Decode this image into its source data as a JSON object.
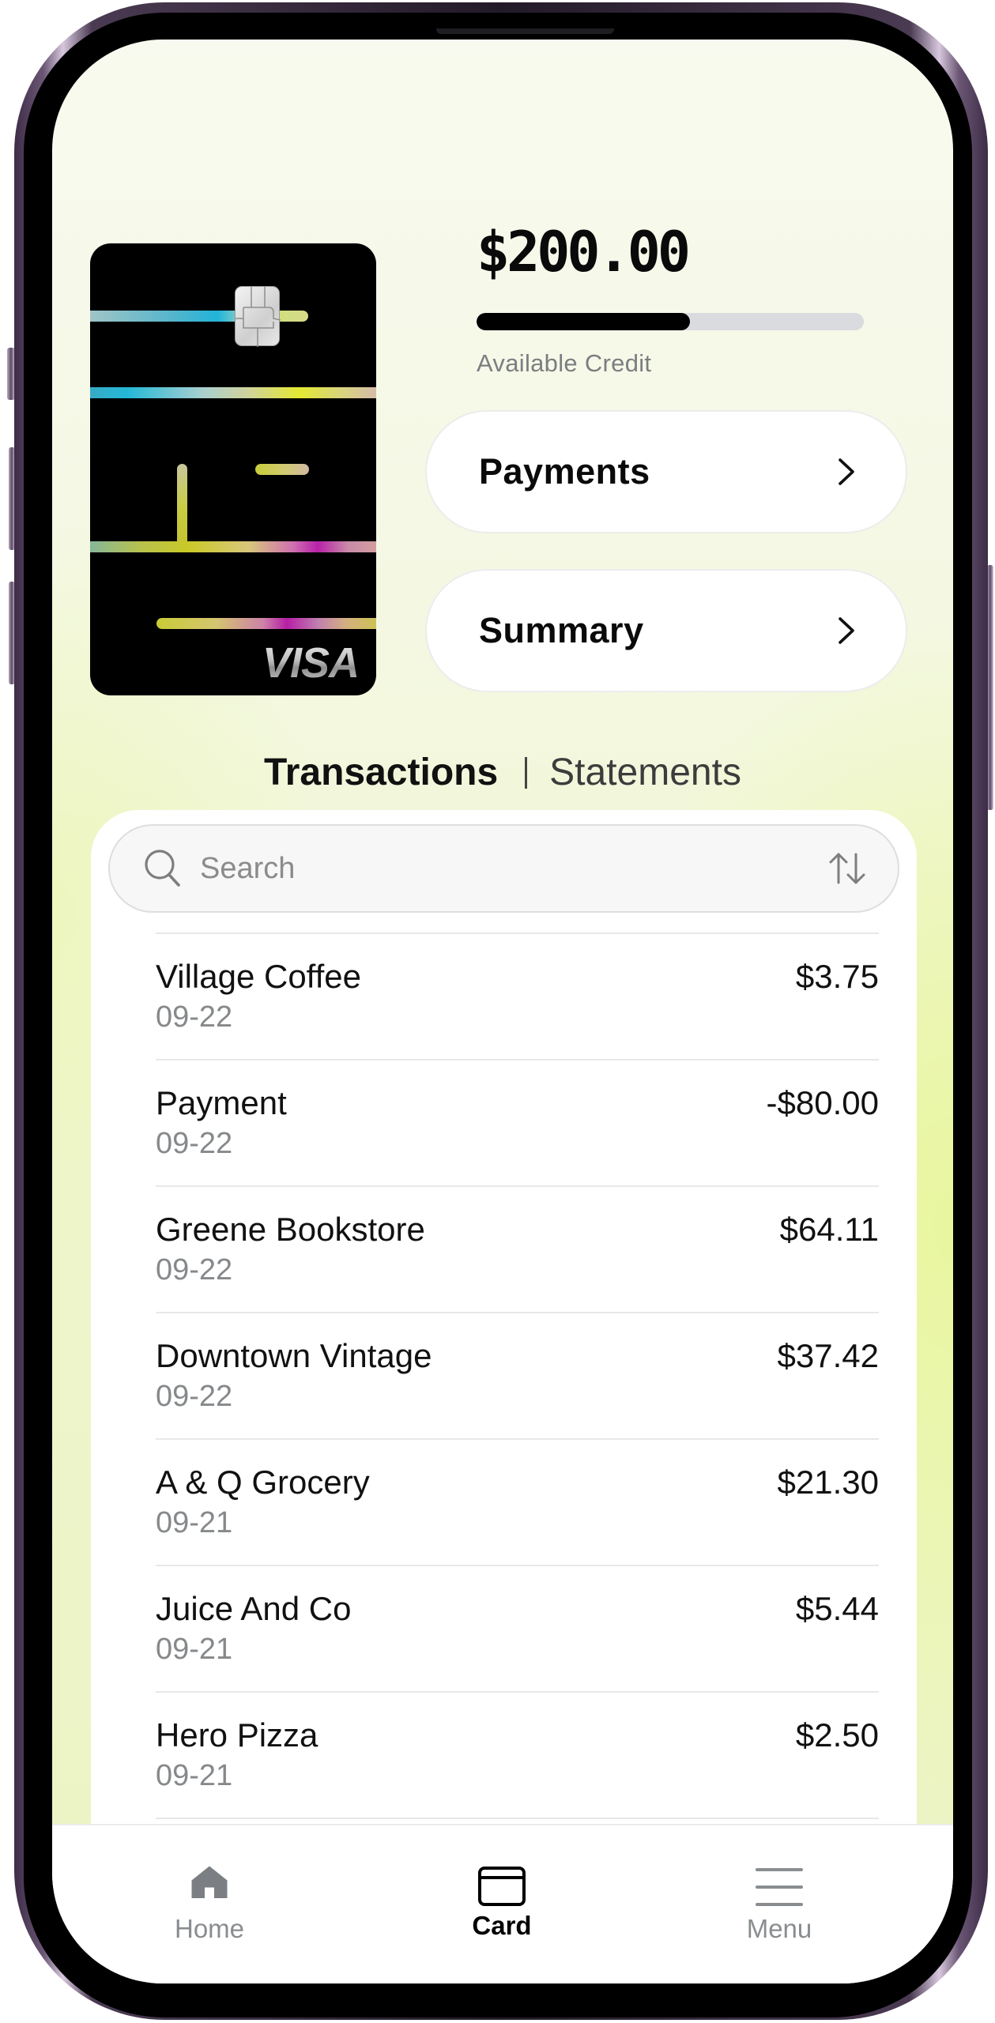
{
  "account": {
    "balance": "$200.00",
    "balance_label": "Available Credit",
    "credit_used_fraction": 0.55
  },
  "card": {
    "network": "VISA",
    "icon": "credit-card-visa"
  },
  "actions": [
    {
      "label": "Payments",
      "icon": "chevron-right-icon"
    },
    {
      "label": "Summary",
      "icon": "chevron-right-icon"
    }
  ],
  "segments": {
    "active": "Transactions",
    "divider": "|",
    "inactive": "Statements"
  },
  "search": {
    "placeholder": "Search",
    "value": "",
    "icon": "search-icon",
    "sort_icon": "sort-arrows-icon"
  },
  "transactions": [
    {
      "name": "Village Coffee",
      "date": "09-22",
      "amount": "$3.75"
    },
    {
      "name": "Payment",
      "date": "09-22",
      "amount": "-$80.00"
    },
    {
      "name": "Greene Bookstore",
      "date": "09-22",
      "amount": "$64.11"
    },
    {
      "name": "Downtown Vintage",
      "date": "09-22",
      "amount": "$37.42"
    },
    {
      "name": "A & Q Grocery",
      "date": "09-21",
      "amount": "$21.30"
    },
    {
      "name": "Juice And Co",
      "date": "09-21",
      "amount": "$5.44"
    },
    {
      "name": "Hero Pizza",
      "date": "09-21",
      "amount": "$2.50"
    }
  ],
  "tabbar": {
    "items": [
      {
        "label": "Home",
        "icon": "home-icon",
        "active": false
      },
      {
        "label": "Card",
        "icon": "card-icon",
        "active": true
      },
      {
        "label": "Menu",
        "icon": "menu-icon",
        "active": false
      }
    ]
  },
  "colors": {
    "text_primary": "#0a0a0a",
    "text_secondary": "#86898b",
    "progress_fill": "#000000",
    "progress_track": "#d9dbde",
    "background_tint": "#eef5cc",
    "tab_inactive": "#8a8d90"
  }
}
